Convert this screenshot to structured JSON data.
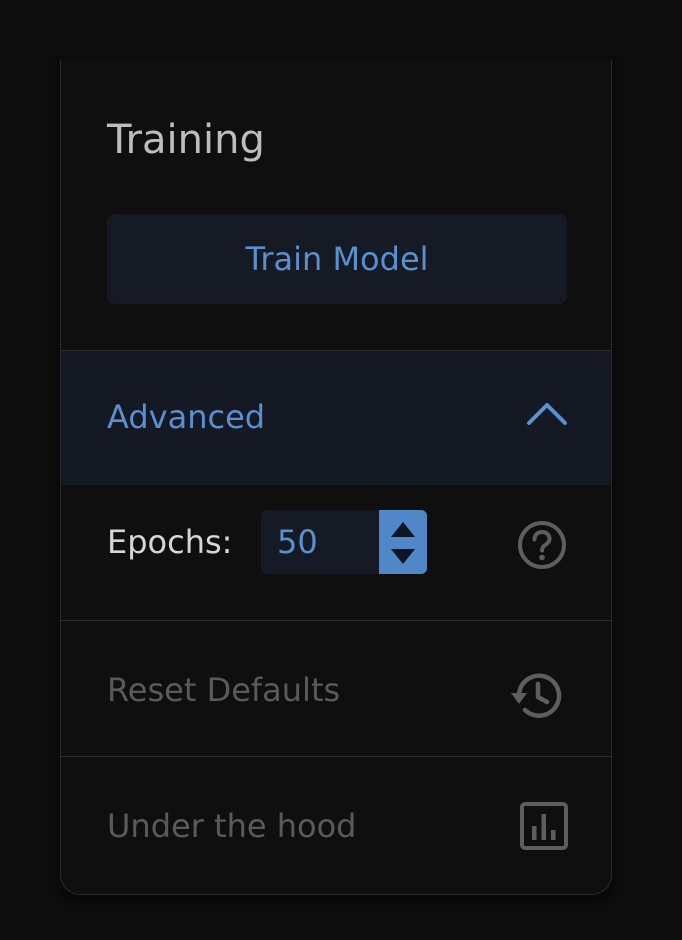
{
  "panel": {
    "title": "Training",
    "train_button_label": "Train Model",
    "advanced": {
      "label": "Advanced",
      "expanded": true,
      "toggle_icon": "chevron-up-icon"
    },
    "epochs": {
      "label": "Epochs:",
      "value": "50",
      "stepper_icon": "up-down-arrows-icon",
      "help_icon": "question-circle-icon"
    },
    "reset_defaults": {
      "label": "Reset Defaults",
      "icon": "history-icon"
    },
    "under_the_hood": {
      "label": "Under the hood",
      "icon": "bar-chart-icon"
    }
  },
  "colors": {
    "background": "#0d0d0d",
    "panel": "#0f0f0f",
    "accent": "#5a8fd0",
    "button_bg": "#151a24",
    "muted_text": "#5a5a5a",
    "title_text": "#bdbdbd"
  }
}
